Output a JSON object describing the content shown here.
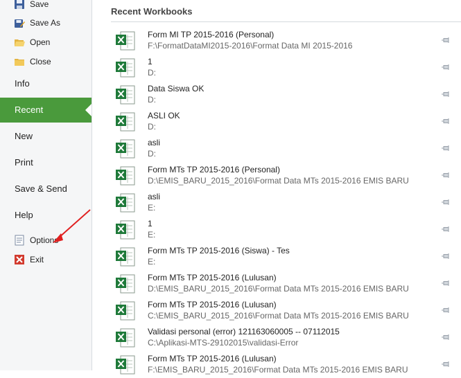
{
  "nav": {
    "save": "Save",
    "save_as": "Save As",
    "open": "Open",
    "close": "Close",
    "info": "Info",
    "recent": "Recent",
    "new": "New",
    "print": "Print",
    "save_send": "Save & Send",
    "help": "Help",
    "options": "Options",
    "exit": "Exit"
  },
  "recent": {
    "title": "Recent Workbooks",
    "items": [
      {
        "name": "Form MI TP 2015-2016 (Personal)",
        "path": "F:\\FormatDataMI2015-2016\\Format Data MI 2015-2016"
      },
      {
        "name": "1",
        "path": "D:"
      },
      {
        "name": "Data Siswa OK",
        "path": "D:"
      },
      {
        "name": "ASLI OK",
        "path": "D:"
      },
      {
        "name": "asli",
        "path": "D:"
      },
      {
        "name": "Form MTs TP 2015-2016 (Personal)",
        "path": "D:\\EMIS_BARU_2015_2016\\Format Data MTs 2015-2016 EMIS BARU"
      },
      {
        "name": "asli",
        "path": "E:"
      },
      {
        "name": "1",
        "path": "E:"
      },
      {
        "name": "Form MTs TP 2015-2016 (Siswa) - Tes",
        "path": "E:"
      },
      {
        "name": "Form MTs TP 2015-2016 (Lulusan)",
        "path": "D:\\EMIS_BARU_2015_2016\\Format Data MTs 2015-2016 EMIS BARU"
      },
      {
        "name": "Form MTs TP 2015-2016 (Lulusan)",
        "path": "C:\\EMIS_BARU_2015_2016\\Format Data MTs 2015-2016 EMIS BARU"
      },
      {
        "name": "Validasi personal (error) 121163060005 -- 07112015",
        "path": "C:\\Aplikasi-MTS-29102015\\validasi-Error"
      },
      {
        "name": "Form MTs TP 2015-2016 (Lulusan)",
        "path": "F:\\EMIS_BARU_2015_2016\\Format Data MTs 2015-2016 EMIS BARU"
      }
    ]
  },
  "colors": {
    "active": "#4a9a3c",
    "excel_green": "#1f7a3a",
    "annotation": "#e02020"
  }
}
